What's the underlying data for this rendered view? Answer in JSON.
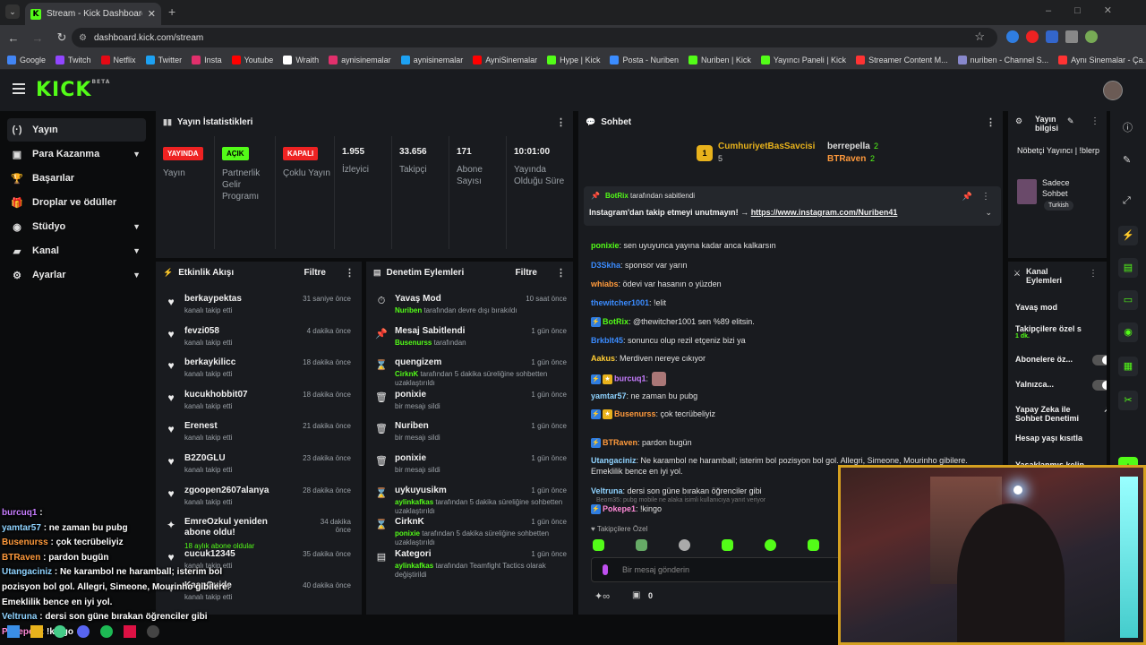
{
  "browser": {
    "tab_title": "Stream - Kick Dashboard",
    "url": "dashboard.kick.com/stream",
    "bookmarks": [
      "Google",
      "Twitch",
      "Netflix",
      "Twitter",
      "Insta",
      "Youtube",
      "Wraith",
      "aynisinemalar",
      "aynisinemalar",
      "AyniSinemalar",
      "Hype | Kick",
      "Posta - Nuriben",
      "Nuriben | Kick",
      "Yayıncı Paneli | Kick",
      "Streamer Content M...",
      "nuriben - Channel S...",
      "Aynı Sinemalar - Ça..."
    ]
  },
  "app": {
    "logo": "KICK",
    "logo_sup": "BETA"
  },
  "sidebar": {
    "items": [
      {
        "label": "Yayın",
        "icon": "(·)"
      },
      {
        "label": "Para Kazanma",
        "icon": "▣"
      },
      {
        "label": "Başarılar",
        "icon": "🏆"
      },
      {
        "label": "Droplar ve ödüller",
        "icon": "🎁"
      },
      {
        "label": "Stüdyo",
        "icon": "◉"
      },
      {
        "label": "Kanal",
        "icon": "▰"
      },
      {
        "label": "Ayarlar",
        "icon": "⚙"
      }
    ]
  },
  "stats": {
    "title": "Yayın İstatistikleri",
    "cells": [
      {
        "badge": "YAYINDA",
        "label": "Yayın"
      },
      {
        "badge": "AÇIK",
        "label": "Partnerlik Gelir Programı"
      },
      {
        "badge": "KAPALI",
        "label": "Çoklu Yayın"
      },
      {
        "value": "1.955",
        "label": "İzleyici"
      },
      {
        "value": "33.656",
        "label": "Takipçi"
      },
      {
        "value": "171",
        "label": "Abone Sayısı"
      },
      {
        "value": "10:01:00",
        "label": "Yayında Olduğu Süre"
      }
    ]
  },
  "activity": {
    "title": "Etkinlik Akışı",
    "filter": "Filtre",
    "events": [
      {
        "name": "berkaypektas",
        "sub": "kanalı takip etti",
        "time": "31 saniye önce"
      },
      {
        "name": "fevzi058",
        "sub": "kanalı takip etti",
        "time": "4 dakika önce"
      },
      {
        "name": "berkaykilicc",
        "sub": "kanalı takip etti",
        "time": "18 dakika önce"
      },
      {
        "name": "kucukhobbit07",
        "sub": "kanalı takip etti",
        "time": "18 dakika önce"
      },
      {
        "name": "Erenest",
        "sub": "kanalı takip etti",
        "time": "21 dakika önce"
      },
      {
        "name": "B2Z0GLU",
        "sub": "kanalı takip etti",
        "time": "23 dakika önce"
      },
      {
        "name": "zgoopen2607alanya",
        "sub": "kanalı takip etti",
        "time": "28 dakika önce"
      },
      {
        "name": "EmreOzkul yeniden abone oldu!",
        "sub": "18 aylık abone oldular",
        "time": "34 dakika önce"
      },
      {
        "name": "cucuk12345",
        "sub": "kanalı takip etti",
        "time": "35 dakika önce"
      },
      {
        "name": "KaanGuide",
        "sub": "kanalı takip etti",
        "time": "40 dakika önce"
      }
    ]
  },
  "moderation": {
    "title": "Denetim Eylemleri",
    "filter": "Filtre",
    "items": [
      {
        "title": "Yavaş Mod",
        "actor": "Nuriben",
        "text": " tarafından devre dışı bırakıldı",
        "time": "10 saat önce",
        "icon": "⏱"
      },
      {
        "title": "Mesaj Sabitlendi",
        "actor": "Busenurss",
        "text": " tarafından",
        "time": "1 gün önce",
        "icon": "📌"
      },
      {
        "title": "quengizem",
        "actor": "CirknK",
        "text": " tarafından 5 dakika süreliğine sohbetten uzaklaştırıldı",
        "time": "1 gün önce",
        "icon": "⌛"
      },
      {
        "title": "ponixie",
        "actor": "",
        "text": "bir mesajı sildi",
        "time": "1 gün önce",
        "icon": "🗑"
      },
      {
        "title": "Nuriben",
        "actor": "",
        "text": "bir mesajı sildi",
        "time": "1 gün önce",
        "icon": "🗑"
      },
      {
        "title": "ponixie",
        "actor": "",
        "text": "bir mesajı sildi",
        "time": "1 gün önce",
        "icon": "🗑"
      },
      {
        "title": "uykuyusikm",
        "actor": "aylinkafkas",
        "text": " tarafından 5 dakika süreliğine sohbetten uzaklaştırıldı",
        "time": "1 gün önce",
        "icon": "⌛"
      },
      {
        "title": "CirknK",
        "actor": "ponixie",
        "text": " tarafından 5 dakika süreliğine sohbetten uzaklaştırıldı",
        "time": "1 gün önce",
        "icon": "⌛"
      },
      {
        "title": "Kategori",
        "actor": "aylinkafkas",
        "text": " tarafından Teamfight Tactics olarak değiştirildi",
        "time": "1 gün önce",
        "icon": "▤"
      }
    ]
  },
  "chat": {
    "title": "Sohbet",
    "leaders": [
      {
        "name": "CumhuriyetBasSavcisi",
        "count": "5"
      },
      {
        "name": "berrepella",
        "count": "2"
      },
      {
        "name": "BTRaven",
        "count": "2"
      }
    ],
    "pinned_by": "BotRix",
    "pinned_suffix": " tarafından sabitlendi",
    "pinned_text": "Instagram'dan takip etmeyi unutmayın! → ",
    "pinned_link": "https://www.instagram.com/Nuriben41",
    "messages": [
      {
        "user": "ponixie",
        "color": "#53fc18",
        "text": ": sen uyuyunca yayına kadar anca kalkarsın"
      },
      {
        "user": "D3Skha",
        "color": "#3b8cff",
        "text": ": sponsor var yarın"
      },
      {
        "user": "whiabs",
        "color": "#ff9a3c",
        "text": ": ödevi var hasanın o yüzden"
      },
      {
        "user": "thewitcher1001",
        "color": "#3b8cff",
        "text": ": !elit"
      },
      {
        "user": "BotRix",
        "color": "#53fc18",
        "text": ": @thewitcher1001 sen %89 elitsin."
      },
      {
        "user": "Brkblt45",
        "color": "#3b8cff",
        "text": ": sonuncu olup rezil etçeniz bizi ya"
      },
      {
        "user": "Aakus",
        "color": "#ffcc33",
        "text": ": Merdiven nereye cıkıyor"
      },
      {
        "user": "burcuq1",
        "color": "#c77dff",
        "text": ":"
      },
      {
        "user": "yamtar57",
        "color": "#8fd3ff",
        "text": ": ne zaman bu pubg"
      },
      {
        "user": "Busenurss",
        "color": "#ff9a3c",
        "text": ": çok tecrübeliyiz"
      },
      {
        "user": "BTRaven",
        "color": "#ff9a3c",
        "text": ": pardon bugün"
      },
      {
        "user": "Utangaciniz",
        "color": "#8fd3ff",
        "text": ": Ne karambol ne haramball; isterim bol pozisyon bol gol. Allegri, Simeone, Mourinho gibilere. Emeklilik bence en iyi yol."
      },
      {
        "user": "Veltruna",
        "color": "#8fd3ff",
        "text": ": dersi son güne bırakan öğrenciler gibi"
      },
      {
        "user": "Pokepe1",
        "color": "#ff8ad8",
        "text": ": !kingo"
      }
    ],
    "reply_note": "Beom35: pubg mobile ne alaka isimli kullanıcıya yanıt veriyor",
    "followers_only": "Takipçilere Özel",
    "input_placeholder": "Bir mesaj gönderin",
    "footer_count": "0"
  },
  "stream_info": {
    "title": "Yayın bilgisi",
    "stream_title": "Nöbetçi Yayıncı | !blerp",
    "category": "Sadece Sohbet",
    "tag": "Turkish"
  },
  "channel_actions": {
    "title": "Kanal Eylemleri",
    "items": [
      {
        "label": "Yavaş mod",
        "type": "arrow",
        "sub": ""
      },
      {
        "label": "Takipçilere özel s",
        "type": "arrow",
        "sub": "1 dk."
      },
      {
        "label": "Abonelere öz...",
        "type": "toggle",
        "sub": ""
      },
      {
        "label": "Yalnızca...",
        "type": "toggle",
        "sub": ""
      },
      {
        "label": "Yapay Zeka ile Sohbet Denetimi",
        "type": "ext",
        "sub": ""
      },
      {
        "label": "Hesap yaşı kısıtla",
        "type": "arrow",
        "sub": ""
      },
      {
        "label": "Yasaklanmış kelin",
        "type": "arrow",
        "sub": ""
      }
    ]
  },
  "overlay": {
    "lines": [
      {
        "user": "burcuq1",
        "color": "#c77dff",
        "text": " :"
      },
      {
        "user": "yamtar57",
        "color": "#8fd3ff",
        "text": " : ne zaman bu pubg"
      },
      {
        "user": "Busenurss",
        "color": "#ff9a3c",
        "text": " : çok tecrübeliyiz"
      },
      {
        "user": "BTRaven",
        "color": "#ff9a3c",
        "text": " : pardon bugün"
      },
      {
        "user": "Utangaciniz",
        "color": "#8fd3ff",
        "text": " : Ne karambol ne haramball; isterim bol"
      },
      {
        "user": "",
        "color": "#fff",
        "text": "pozisyon bol gol. Allegri, Simeone, Mourinho gibilere."
      },
      {
        "user": "",
        "color": "#fff",
        "text": "Emeklilik bence en iyi yol."
      },
      {
        "user": "Veltruna",
        "color": "#8fd3ff",
        "text": " : dersi son güne bırakan öğrenciler gibi"
      },
      {
        "user": "Pokepe1",
        "color": "#ff8ad8",
        "text": " : !kingo"
      }
    ]
  }
}
